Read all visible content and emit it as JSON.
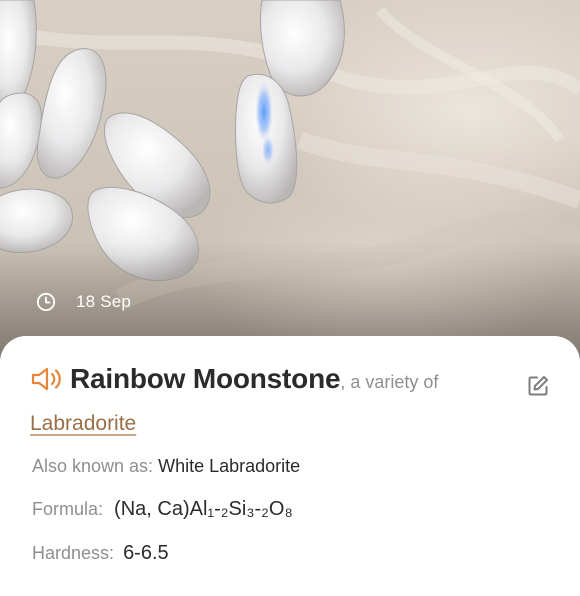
{
  "photo": {
    "subject": "moonstone tumbled stones on marble",
    "date_icon": "clock-icon",
    "date": "18 Sep"
  },
  "card": {
    "icons": {
      "speaker": "speaker-icon",
      "edit": "edit-icon"
    },
    "accent_color": "#e8853b",
    "link_color": "#9a6f47",
    "title": "Rainbow Moonstone",
    "variety_text": ", a variety of",
    "parent_mineral": "Labradorite",
    "aka_label": "Also known as:",
    "aka_value": "White Labradorite",
    "formula_label": "Formula:",
    "formula_value": "(Na, Ca)Al₁-₂Si₃-₂O₈",
    "hardness_label": "Hardness:",
    "hardness_value": "6-6.5"
  }
}
